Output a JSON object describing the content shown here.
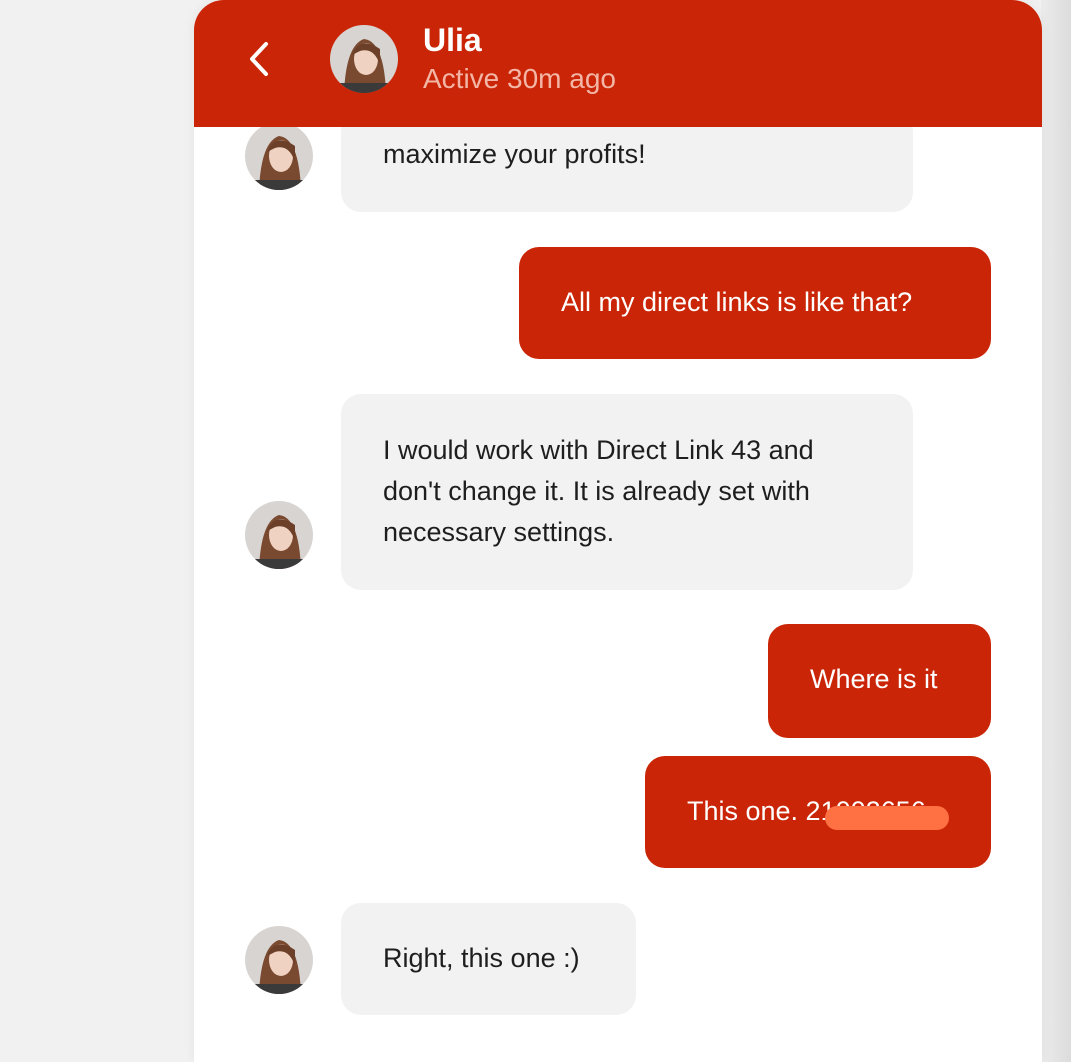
{
  "header": {
    "contact_name": "Ulia",
    "status": "Active 30m ago",
    "back_icon": "chevron-left-icon",
    "background_color": "#c92506"
  },
  "messages": [
    {
      "from": "contact",
      "text": "maximize your profits!"
    },
    {
      "from": "me",
      "text": "All my direct links is like that?"
    },
    {
      "from": "contact",
      "text": "I would work with Direct Link 43 and don't change it. It is already set with necessary settings."
    },
    {
      "from": "me",
      "text": "Where is it"
    },
    {
      "from": "me",
      "text": "This one. 21002656",
      "note_redacted": true
    },
    {
      "from": "contact",
      "text": "Right, this one :)"
    }
  ],
  "colors": {
    "outgoing_bubble": "#c92506",
    "incoming_bubble": "#f2f2f2",
    "redaction_mark": "#ff7043"
  }
}
